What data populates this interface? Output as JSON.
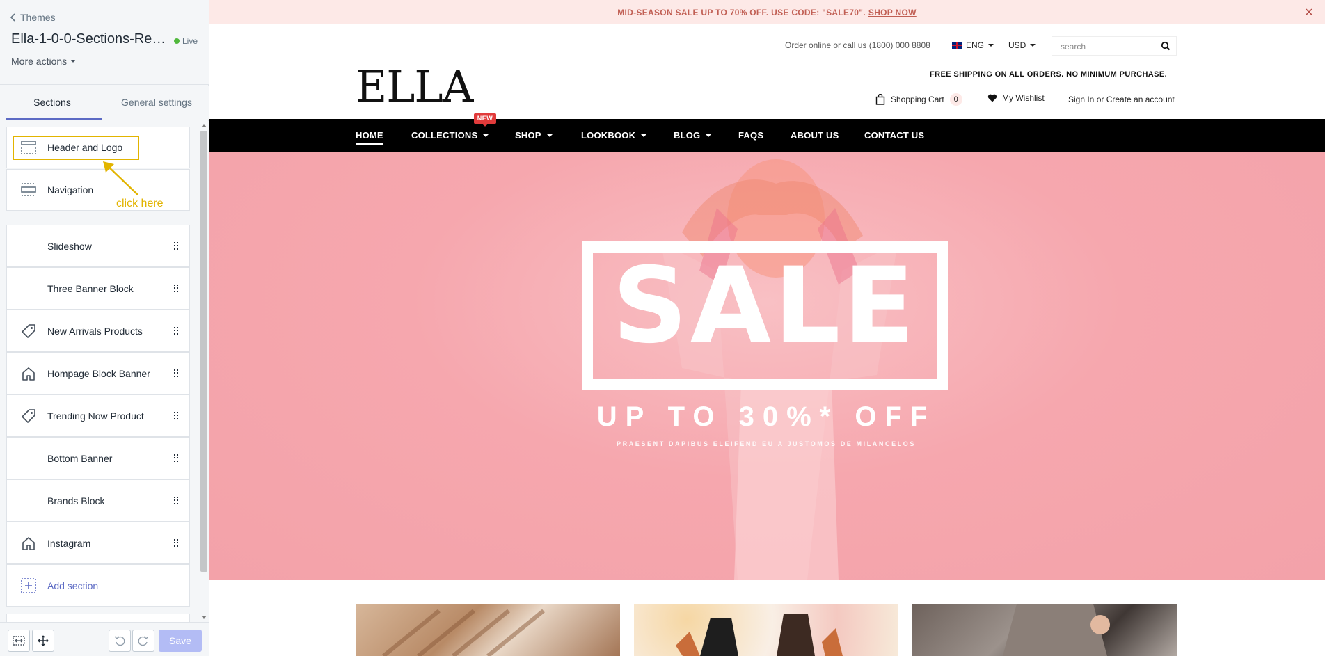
{
  "sidebar": {
    "back_label": "Themes",
    "theme_name": "Ella-1-0-0-Sections-Rea...",
    "live_label": "Live",
    "more_actions": "More actions",
    "tabs": [
      {
        "label": "Sections"
      },
      {
        "label": "General settings"
      }
    ],
    "sections": [
      {
        "label": "Header and Logo",
        "icon": "header-icon"
      },
      {
        "label": "Navigation",
        "icon": "navigation-icon"
      },
      {
        "label": "Slideshow",
        "icon": "thumbnail"
      },
      {
        "label": "Three Banner Block",
        "icon": "thumbnail"
      },
      {
        "label": "New Arrivals Products",
        "icon": "tag-icon"
      },
      {
        "label": "Hompage Block Banner",
        "icon": "home-icon"
      },
      {
        "label": "Trending Now Product",
        "icon": "tag-icon"
      },
      {
        "label": "Bottom Banner",
        "icon": "thumbnail"
      },
      {
        "label": "Brands Block",
        "icon": "thumbnail"
      },
      {
        "label": "Instagram",
        "icon": "home-icon"
      }
    ],
    "add_section": "Add section",
    "annotation": "click here",
    "save_label": "Save",
    "accent": "#5c6ac4",
    "annotation_color": "#e2b400"
  },
  "store": {
    "promo_text": "MID-SEASON SALE UP TO 70% OFF. USE CODE: \"SALE70\".",
    "promo_link": "SHOP NOW",
    "promo_close": "✕",
    "call_text": "Order online or call us (1800) 000 8808",
    "language": "ENG",
    "currency": "USD",
    "search_placeholder": "search",
    "logo": "ELLA",
    "free_shipping": "FREE SHIPPING ON ALL ORDERS. NO MINIMUM PURCHASE.",
    "cart_label": "Shopping Cart",
    "cart_count": "0",
    "wishlist_label": "My Wishlist",
    "account_label": "Sign In or Create an account",
    "nav": [
      "HOME",
      "COLLECTIONS",
      "SHOP",
      "LOOKBOOK",
      "BLOG",
      "FAQS",
      "ABOUT US",
      "CONTACT US"
    ],
    "new_tag": "NEW",
    "hero": {
      "title": "SALE",
      "subtitle": "UP TO 30%* OFF",
      "caption": "PRAESENT DAPIBUS ELEIFEND EU A JUSTOMOS DE MILANCELOS"
    }
  }
}
